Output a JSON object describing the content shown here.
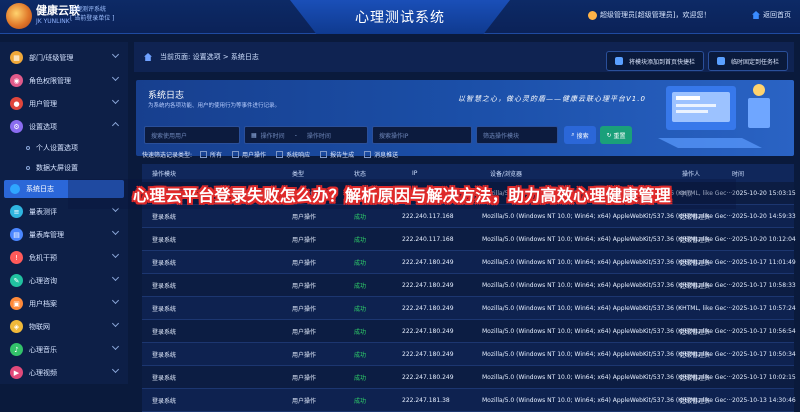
{
  "header": {
    "logo_cn": "健康云联",
    "logo_en": "JK YUNLINK",
    "subtitle_line1": "心理测评系统",
    "subtitle_line2": "[ 当前登录单位 ]",
    "app_title": "心理测试系统",
    "user_text": "超级管理员[超级管理员]，欢迎您！",
    "home_text": "返回首页"
  },
  "sidebar": {
    "items": [
      {
        "label": "部门/班级管理",
        "icon": "building-icon",
        "color": "#f0a83a"
      },
      {
        "label": "角色权限管理",
        "icon": "role-icon",
        "color": "#e05a8a"
      },
      {
        "label": "用户管理",
        "icon": "user-icon",
        "color": "#e0463c"
      },
      {
        "label": "设置选项",
        "icon": "gear-icon",
        "color": "#8a6cf0"
      },
      {
        "label": "个人设置选项",
        "icon": "dot-icon"
      },
      {
        "label": "数据大屏设置",
        "icon": "dot-icon"
      },
      {
        "label": "系统日志",
        "icon": "log-icon",
        "color": "#2fa6ff"
      },
      {
        "label": "量表测评",
        "icon": "scale-icon",
        "color": "#2fb5e0"
      },
      {
        "label": "量表库管理",
        "icon": "library-icon",
        "color": "#4a86ff"
      },
      {
        "label": "危机干预",
        "icon": "alert-icon",
        "color": "#ff5a5a"
      },
      {
        "label": "心理咨询",
        "icon": "chat-icon",
        "color": "#21c1a0"
      },
      {
        "label": "用户档案",
        "icon": "file-icon",
        "color": "#ff8a3a"
      },
      {
        "label": "物联网",
        "icon": "iot-icon",
        "color": "#f0b93a"
      },
      {
        "label": "心理音乐",
        "icon": "music-icon",
        "color": "#33c26a"
      },
      {
        "label": "心理视频",
        "icon": "video-icon",
        "color": "#e04a7a"
      }
    ]
  },
  "breadcrumb": "当前页面: 设置选项 > 系统日志",
  "actions": {
    "add_shortcut": "将模块添加到首页快捷栏",
    "pin_tab": "临时固定到任务栏"
  },
  "banner": {
    "title": "系统日志",
    "desc": "为系统内各项功能、用户的使用行为等事件进行记录。",
    "slogan": "以智慧之心，做心灵的盾——健康云联心理平台V1.0"
  },
  "filters": {
    "user_placeholder": "搜索使用用户",
    "start_placeholder": "操作时间",
    "end_placeholder": "操作时间",
    "ip_placeholder": "搜索操作IP",
    "module_placeholder": "筛选操作模块",
    "search_btn": "搜索",
    "reset_btn": "重置"
  },
  "quick_filter": {
    "label": "快速筛选记录类型:",
    "options": [
      "所有",
      "用户操作",
      "系统响应",
      "报告生成",
      "消息推送"
    ]
  },
  "table": {
    "headers": [
      "操作模块",
      "类型",
      "状态",
      "IP",
      "设备/浏览器",
      "操作人",
      "时间"
    ],
    "rows": [
      {
        "module": "登录系统",
        "type": "用户操作",
        "status": "成功",
        "ip": "123.4.101.154",
        "ua": "Mozilla/5.0 (Windows NT 10.0; Win64; x64) AppleWebKit/537.36 (KHTML, like Gec···",
        "user": "李欣",
        "time": "2025-10-20 15:03:15"
      },
      {
        "module": "登录系统",
        "type": "用户操作",
        "status": "成功",
        "ip": "222.240.117.168",
        "ua": "Mozilla/5.0 (Windows NT 10.0; Win64; x64) AppleWebKit/537.36 (KHTML, like Gec···",
        "user": "超级管理员",
        "time": "2025-10-20 14:59:33"
      },
      {
        "module": "登录系统",
        "type": "用户操作",
        "status": "成功",
        "ip": "222.240.117.168",
        "ua": "Mozilla/5.0 (Windows NT 10.0; Win64; x64) AppleWebKit/537.36 (KHTML, like Gec···",
        "user": "超级管理员",
        "time": "2025-10-20 10:12:04"
      },
      {
        "module": "登录系统",
        "type": "用户操作",
        "status": "成功",
        "ip": "222.247.180.249",
        "ua": "Mozilla/5.0 (Windows NT 10.0; Win64; x64) AppleWebKit/537.36 (KHTML, like Gec···",
        "user": "超级管理员",
        "time": "2025-10-17 11:01:49"
      },
      {
        "module": "登录系统",
        "type": "用户操作",
        "status": "成功",
        "ip": "222.247.180.249",
        "ua": "Mozilla/5.0 (Windows NT 10.0; Win64; x64) AppleWebKit/537.36 (KHTML, like Gec···",
        "user": "超级管理员",
        "time": "2025-10-17 10:58:33"
      },
      {
        "module": "登录系统",
        "type": "用户操作",
        "status": "成功",
        "ip": "222.247.180.249",
        "ua": "Mozilla/5.0 (Windows NT 10.0; Win64; x64) AppleWebKit/537.36 (KHTML, like Gec···",
        "user": "···",
        "time": "2025-10-17 10:57:24"
      },
      {
        "module": "登录系统",
        "type": "用户操作",
        "status": "成功",
        "ip": "222.247.180.249",
        "ua": "Mozilla/5.0 (Windows NT 10.0; Win64; x64) AppleWebKit/537.36 (KHTML, like Gec···",
        "user": "超级管理员",
        "time": "2025-10-17 10:56:54"
      },
      {
        "module": "登录系统",
        "type": "用户操作",
        "status": "成功",
        "ip": "222.247.180.249",
        "ua": "Mozilla/5.0 (Windows NT 10.0; Win64; x64) AppleWebKit/537.36 (KHTML, like Gec···",
        "user": "超级管理员",
        "time": "2025-10-17 10:50:34"
      },
      {
        "module": "登录系统",
        "type": "用户操作",
        "status": "成功",
        "ip": "222.247.180.249",
        "ua": "Mozilla/5.0 (Windows NT 10.0; Win64; x64) AppleWebKit/537.36 (KHTML, like Gec···",
        "user": "超级管理员",
        "time": "2025-10-17 10:02:15"
      },
      {
        "module": "登录系统",
        "type": "用户操作",
        "status": "成功",
        "ip": "222.247.181.38",
        "ua": "Mozilla/5.0 (Windows NT 10.0; Win64; x64) AppleWebKit/537.36 (KHTML, like Gec···",
        "user": "超级管理员",
        "time": "2025-10-13 14:30:46"
      }
    ]
  },
  "overlay": "心理云平台登录失败怎么办？解析原因与解决方法，助力高效心理健康管理",
  "colors": {
    "accent": "#2b67d8",
    "success": "#2fd36a",
    "overlay_outline": "#e02a2a"
  }
}
